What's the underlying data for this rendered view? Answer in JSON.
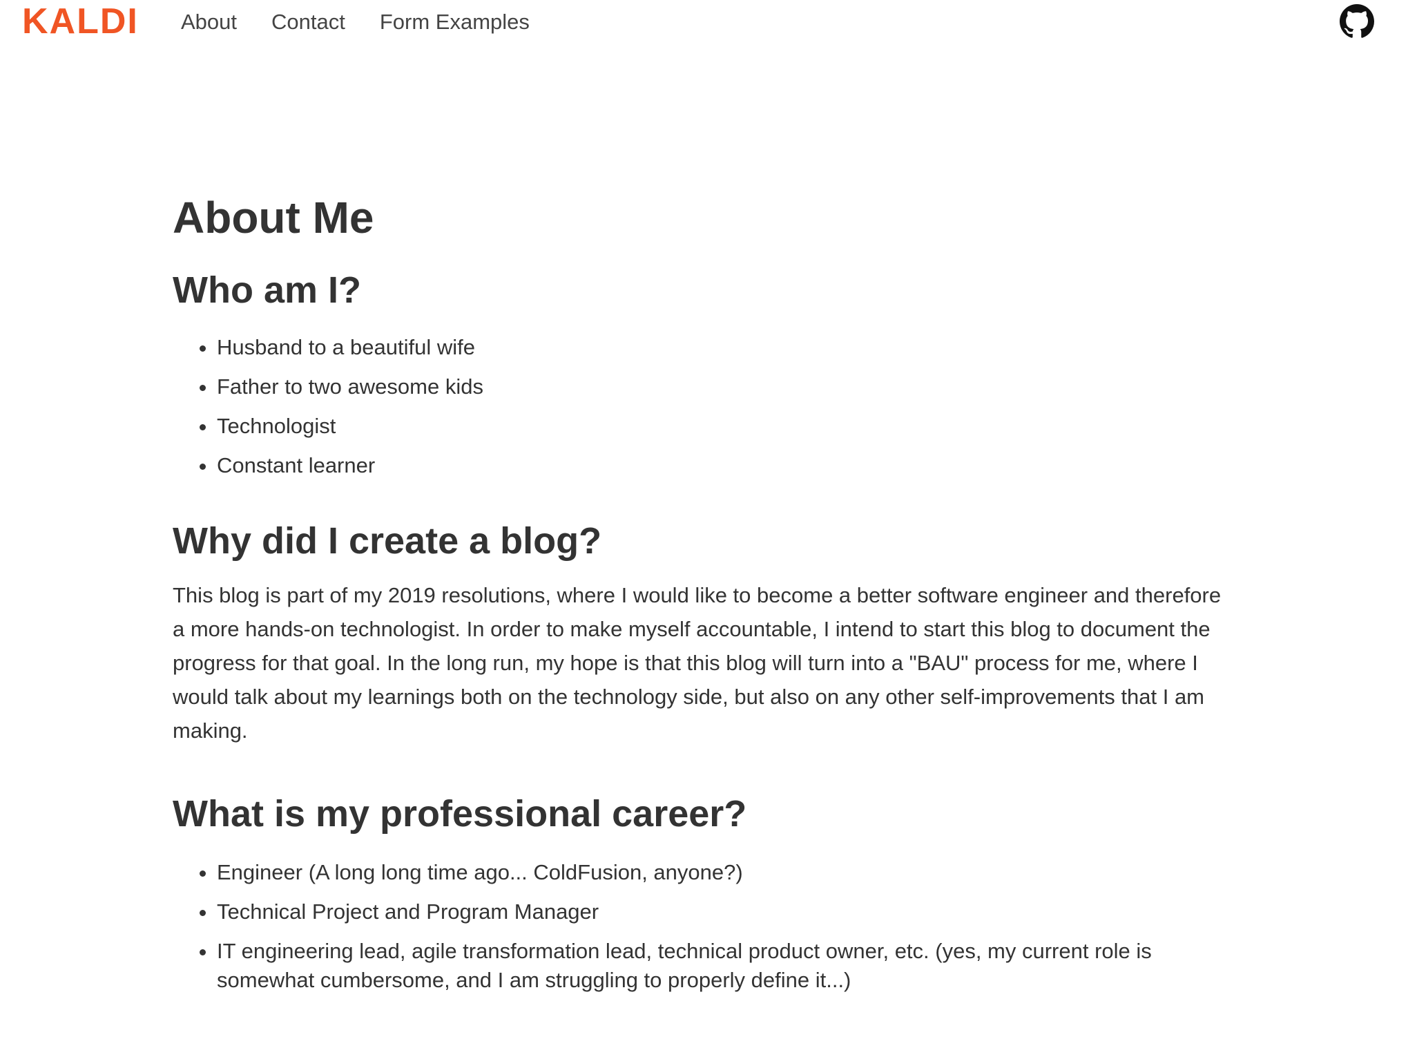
{
  "header": {
    "logo": "KALDI",
    "nav": [
      {
        "label": "About"
      },
      {
        "label": "Contact"
      },
      {
        "label": "Form Examples"
      }
    ],
    "github_icon": "github-icon",
    "accent_color": "#f05524"
  },
  "main": {
    "title": "About Me",
    "sections": [
      {
        "heading": "Who am I?",
        "items": [
          "Husband to a beautiful wife",
          "Father to two awesome kids",
          "Technologist",
          "Constant learner"
        ]
      },
      {
        "heading": "Why did I create a blog?",
        "paragraph": "This blog is part of my 2019 resolutions, where I would like to become a better software engineer and therefore a more hands-on technologist. In order to make myself accountable, I intend to start this blog to document the progress for that goal. In the long run, my hope is that this blog will turn into a \"BAU\" process for me, where I would talk about my learnings both on the technology side, but also on any other self-improvements that I am making."
      },
      {
        "heading": "What is my professional career?",
        "items": [
          "Engineer (A long long time ago... ColdFusion, anyone?)",
          "Technical Project and Program Manager",
          "IT engineering lead, agile transformation lead, technical product owner, etc. (yes, my current role is somewhat cumbersome, and I am struggling to properly define it...)"
        ]
      }
    ]
  }
}
